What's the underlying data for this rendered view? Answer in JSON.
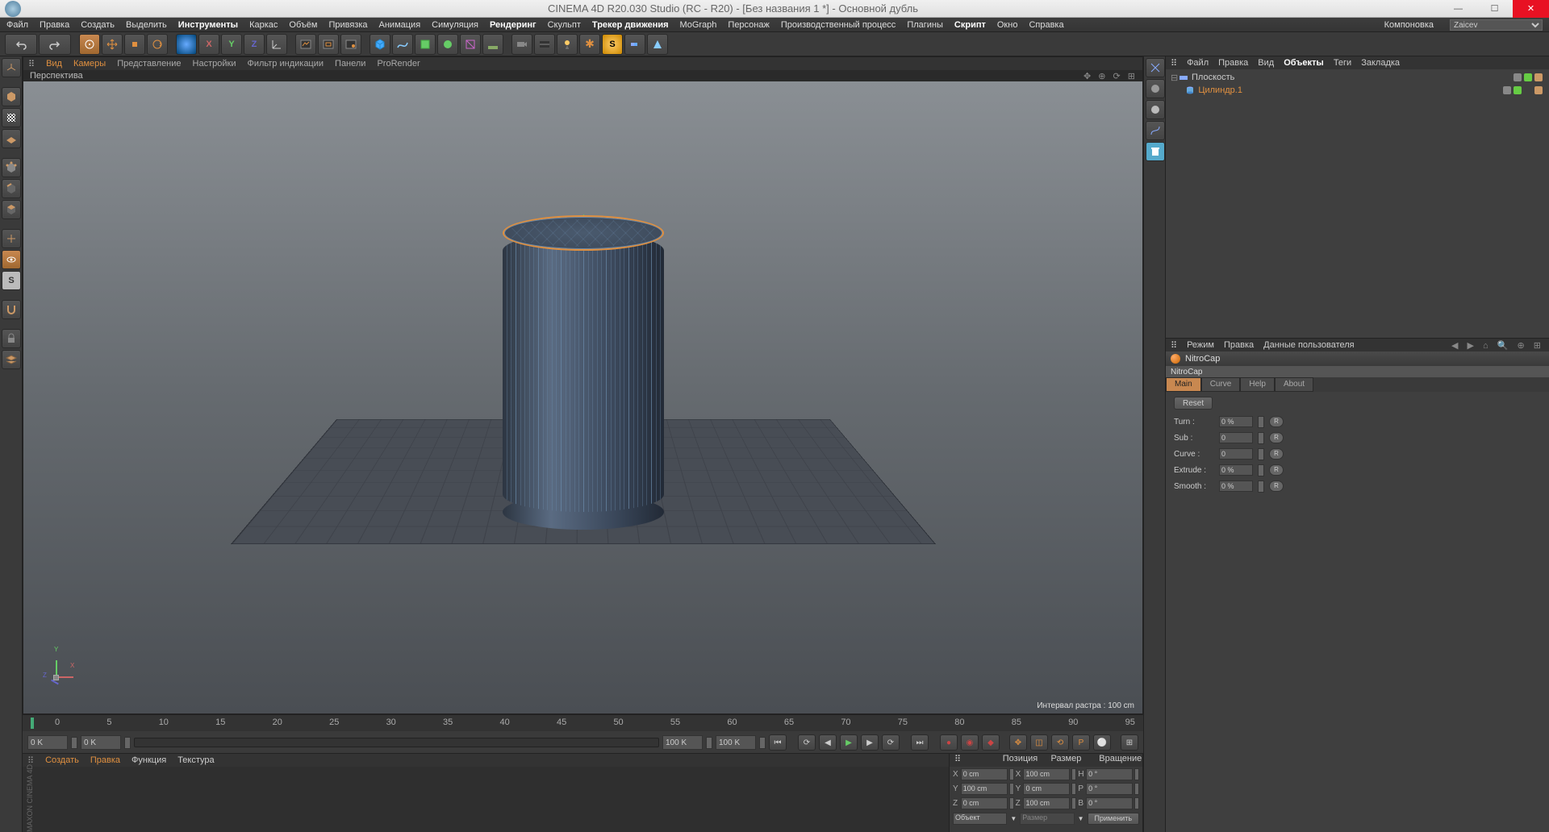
{
  "title": "CINEMA 4D R20.030 Studio (RC - R20) - [Без названия 1 *] - Основной дубль",
  "menubar": {
    "items": [
      "Файл",
      "Правка",
      "Создать",
      "Выделить",
      "Инструменты",
      "Каркас",
      "Объём",
      "Привязка",
      "Анимация",
      "Симуляция",
      "Рендеринг",
      "Скульпт",
      "Трекер движения",
      "MoGraph",
      "Персонаж",
      "Производственный процесс",
      "Плагины",
      "Скрипт",
      "Окно",
      "Справка"
    ],
    "layout_label": "Компоновка",
    "layout_value": "Zaicev"
  },
  "viewport": {
    "menu": [
      "Вид",
      "Камеры",
      "Представление",
      "Настройки",
      "Фильтр индикации",
      "Панели",
      "ProRender"
    ],
    "label": "Перспектива",
    "info": "Интервал растра : 100 cm"
  },
  "timeline": {
    "start": "0 K",
    "end": "100 K",
    "start2": "0 K",
    "end2": "100 K",
    "ticks": [
      "0",
      "5",
      "10",
      "15",
      "20",
      "25",
      "30",
      "35",
      "40",
      "45",
      "50",
      "55",
      "60",
      "65",
      "70",
      "75",
      "80",
      "85",
      "90",
      "95"
    ]
  },
  "material_menu": [
    "Создать",
    "Правка",
    "Функция",
    "Текстура"
  ],
  "brand": "MAXON CINEMA 4D",
  "coords": {
    "headers": [
      "Позиция",
      "Размер",
      "Вращение"
    ],
    "rows": [
      {
        "ax": "X",
        "pos": "0 cm",
        "sizeAx": "X",
        "size": "100 cm",
        "rotAx": "H",
        "rot": "0 °"
      },
      {
        "ax": "Y",
        "pos": "100 cm",
        "sizeAx": "Y",
        "size": "0 cm",
        "rotAx": "P",
        "rot": "0 °"
      },
      {
        "ax": "Z",
        "pos": "0 cm",
        "sizeAx": "Z",
        "size": "100 cm",
        "rotAx": "B",
        "rot": "0 °"
      }
    ],
    "mode1": "Объект",
    "mode2": "Размер",
    "apply": "Применить"
  },
  "obj_panel": {
    "menu": [
      "Файл",
      "Правка",
      "Вид",
      "Объекты",
      "Теги",
      "Закладка"
    ],
    "items": [
      {
        "name": "Плоскость",
        "sel": false
      },
      {
        "name": "Цилиндр.1",
        "sel": true
      }
    ]
  },
  "attr": {
    "menu": [
      "Режим",
      "Правка",
      "Данные пользователя"
    ],
    "title": "NitroCap",
    "sub": "NitroCap",
    "tabs": [
      "Main",
      "Curve",
      "Help",
      "About"
    ],
    "reset": "Reset",
    "params": [
      {
        "label": "Turn :",
        "val": "0 %"
      },
      {
        "label": "Sub :",
        "val": "0"
      },
      {
        "label": "Curve :",
        "val": "0"
      },
      {
        "label": "Extrude :",
        "val": "0 %"
      },
      {
        "label": "Smooth :",
        "val": "0 %"
      }
    ]
  }
}
